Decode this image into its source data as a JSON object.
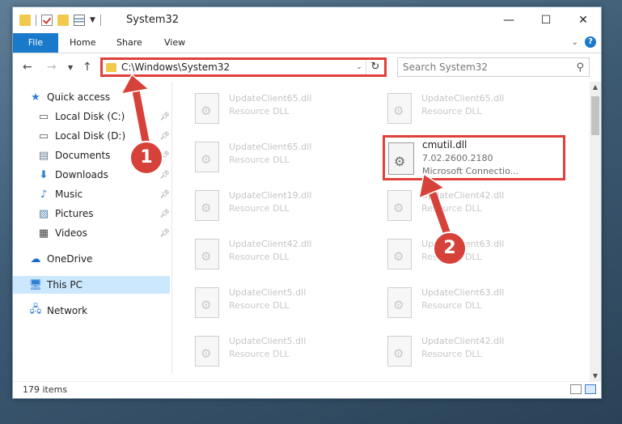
{
  "window": {
    "title": "System32",
    "controls": {
      "minimize": "—",
      "maximize": "☐",
      "close": "✕"
    }
  },
  "ribbon": {
    "tabs": [
      "File",
      "Home",
      "Share",
      "View"
    ],
    "help": "?"
  },
  "address": {
    "path": "C:\\Windows\\System32"
  },
  "search": {
    "placeholder": "Search System32"
  },
  "nav_pane": {
    "items": [
      {
        "label": "Quick access",
        "icon": "star-icon",
        "pinned": false
      },
      {
        "label": "Local Disk (C:)",
        "icon": "drive-icon",
        "pinned": true
      },
      {
        "label": "Local Disk (D:)",
        "icon": "drive-icon",
        "pinned": true
      },
      {
        "label": "Documents",
        "icon": "documents-icon",
        "pinned": true
      },
      {
        "label": "Downloads",
        "icon": "download-icon",
        "pinned": true
      },
      {
        "label": "Music",
        "icon": "music-icon",
        "pinned": true
      },
      {
        "label": "Pictures",
        "icon": "pictures-icon",
        "pinned": true
      },
      {
        "label": "Videos",
        "icon": "videos-icon",
        "pinned": true
      },
      {
        "label": "OneDrive",
        "icon": "cloud-icon",
        "pinned": false
      },
      {
        "label": "This PC",
        "icon": "computer-icon",
        "pinned": false,
        "selected": true
      },
      {
        "label": "Network",
        "icon": "network-icon",
        "pinned": false
      }
    ]
  },
  "files": [
    {
      "name": "UpdateClient65.dll",
      "type": "Resource DLL"
    },
    {
      "name": "UpdateClient65.dll",
      "type": "Resource DLL"
    },
    {
      "name": "UpdateClient65.dll",
      "type": "Resource DLL"
    },
    {
      "name": "UpdateClient19.dll",
      "type": "Resource DLL"
    },
    {
      "name": "UpdateClient42.dll",
      "type": "Resource DLL"
    },
    {
      "name": "UpdateClient42.dll",
      "type": "Resource DLL"
    },
    {
      "name": "UpdateClient63.dll",
      "type": "Resource DLL"
    },
    {
      "name": "UpdateClient5.dll",
      "type": "Resource DLL"
    },
    {
      "name": "UpdateClient63.dll",
      "type": "Resource DLL"
    },
    {
      "name": "UpdateClient5.dll",
      "type": "Resource DLL"
    },
    {
      "name": "UpdateClient42.dll",
      "type": "Resource DLL"
    }
  ],
  "highlighted_file": {
    "name": "cmutil.dll",
    "version": "7.02.2600.2180",
    "description": "Microsoft Connectio..."
  },
  "status": {
    "item_count": "179 items"
  },
  "steps": [
    "1",
    "2"
  ],
  "colors": {
    "accent": "#1979ca",
    "highlight": "#e0403a",
    "selection": "#cce8ff"
  }
}
